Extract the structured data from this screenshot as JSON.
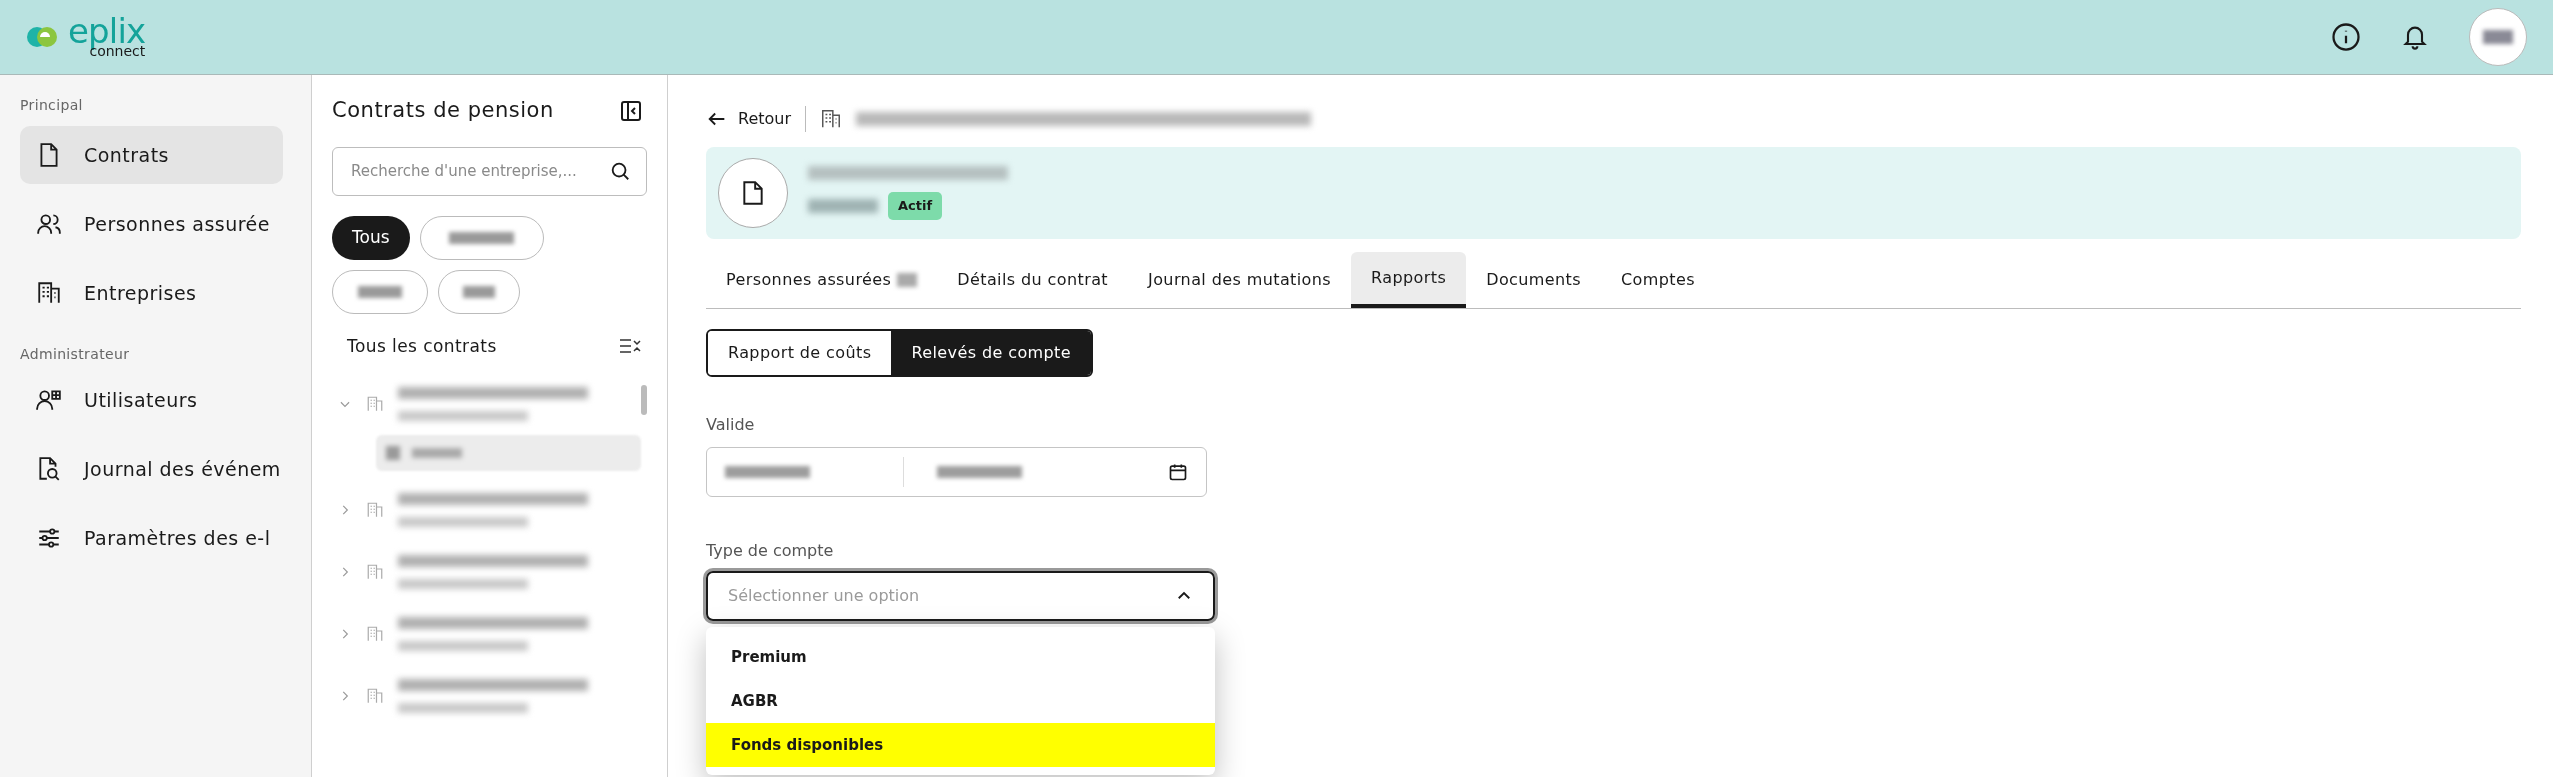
{
  "header": {
    "logo": {
      "name": "eplix",
      "tagline": "connect"
    }
  },
  "sidebar": {
    "sections": [
      {
        "title": "Principal",
        "items": [
          {
            "label": "Contrats",
            "selected": true
          },
          {
            "label": "Personnes assurée",
            "selected": false
          },
          {
            "label": "Entreprises",
            "selected": false
          }
        ]
      },
      {
        "title": "Administrateur",
        "items": [
          {
            "label": "Utilisateurs",
            "selected": false
          },
          {
            "label": "Journal des événem",
            "selected": false
          },
          {
            "label": "Paramètres des e-l",
            "selected": false
          }
        ]
      }
    ]
  },
  "contracts_panel": {
    "title": "Contrats de pension",
    "search": {
      "placeholder": "Recherche d'une entreprise,..."
    },
    "filters": [
      {
        "label": "Tous",
        "selected": true
      },
      {
        "selected": false
      },
      {
        "selected": false
      },
      {
        "selected": false
      }
    ],
    "list_title": "Tous les contrats",
    "tree": [
      {
        "expanded": true,
        "children": [
          {
            "selected": true
          }
        ]
      },
      {
        "expanded": false
      },
      {
        "expanded": false
      },
      {
        "expanded": false
      },
      {
        "expanded": false
      }
    ]
  },
  "main": {
    "back": "Retour",
    "status_badge": "Actif",
    "tabs": [
      {
        "label": "Personnes assurées",
        "selected": false
      },
      {
        "label": "Détails du contrat",
        "selected": false
      },
      {
        "label": "Journal des mutations",
        "selected": false
      },
      {
        "label": "Rapports",
        "selected": true
      },
      {
        "label": "Documents",
        "selected": false
      },
      {
        "label": "Comptes",
        "selected": false
      }
    ],
    "report_types": [
      {
        "label": "Rapport de coûts",
        "selected": false
      },
      {
        "label": "Relevés de compte",
        "selected": true
      }
    ],
    "valid_label": "Valide",
    "account_type": {
      "label": "Type de compte",
      "placeholder": "Sélectionner une option",
      "expanded": true,
      "options": [
        {
          "label": "Premium",
          "highlighted": false
        },
        {
          "label": "AGBR",
          "highlighted": false
        },
        {
          "label": "Fonds disponibles",
          "highlighted": true
        }
      ]
    }
  }
}
